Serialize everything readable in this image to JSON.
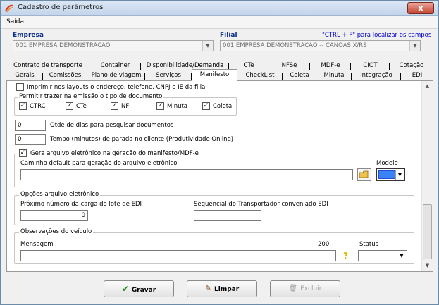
{
  "window": {
    "title": "Cadastro de parâmetros",
    "close": "x"
  },
  "menu": {
    "saida": "Saída"
  },
  "empresa": {
    "label": "Empresa",
    "value": "001 EMPRESA DEMONSTRACAO"
  },
  "filial": {
    "label": "Filial",
    "value": "001 EMPRESA DEMONSTRACAO -- CANOAS X/RS",
    "hint": "\"CTRL + F\" para localizar os campos"
  },
  "tabs_row1": [
    "Contrato de transporte",
    "Container",
    "Disponibilidade/Demanda",
    "CTe",
    "NFSe",
    "MDF-e",
    "CIOT",
    "Cotação"
  ],
  "tabs_row2": [
    "Gerais",
    "Comissões",
    "Plano de viagem",
    "Serviços",
    "Manifesto",
    "CheckList",
    "Coleta",
    "Minuta",
    "Integração",
    "EDI"
  ],
  "active_tab": "Manifesto",
  "form": {
    "imprimir_label": "Imprimir nos layouts o endereço, telefone, CNPJ e IE da filial",
    "permitir_title": "Permitir trazer na emissão o tipo de documento",
    "doc_types": [
      {
        "label": "CTRC",
        "checked": true
      },
      {
        "label": "CTe",
        "checked": true
      },
      {
        "label": "NF",
        "checked": true
      },
      {
        "label": "Minuta",
        "checked": true
      },
      {
        "label": "Coleta",
        "checked": true
      }
    ],
    "qtde_dias_value": "0",
    "qtde_dias_label": "Qtde de dias para pesquisar documentos",
    "tempo_value": "0",
    "tempo_label": "Tempo (minutos) de parada no cliente (Produtividade Online)",
    "gera_arquivo_label": "Gera arquivo eletrônico na geração do manifesto/MDF-e",
    "caminho_label": "Caminho default para geração do arquivo eletrônico",
    "caminho_value": "",
    "modelo_label": "Modelo",
    "opcoes_title": "Opções arquivo eletrônico",
    "proximo_label": "Próximo número da carga do lote de EDI",
    "proximo_value": "0",
    "sequencial_label": "Sequencial do Transportador conveniado EDI",
    "sequencial_value": "",
    "obs_title": "Observações do veículo",
    "mensagem_label": "Mensagem",
    "mensagem_max": "200",
    "mensagem_value": "",
    "status_label": "Status",
    "status_value": ""
  },
  "buttons": {
    "gravar": "Gravar",
    "limpar": "Limpar",
    "excluir": "Excluir"
  },
  "colors": {
    "accent_blue": "#0a2d8c",
    "modelo_color": "#3b82f6",
    "help_icon": "#e8b400"
  }
}
